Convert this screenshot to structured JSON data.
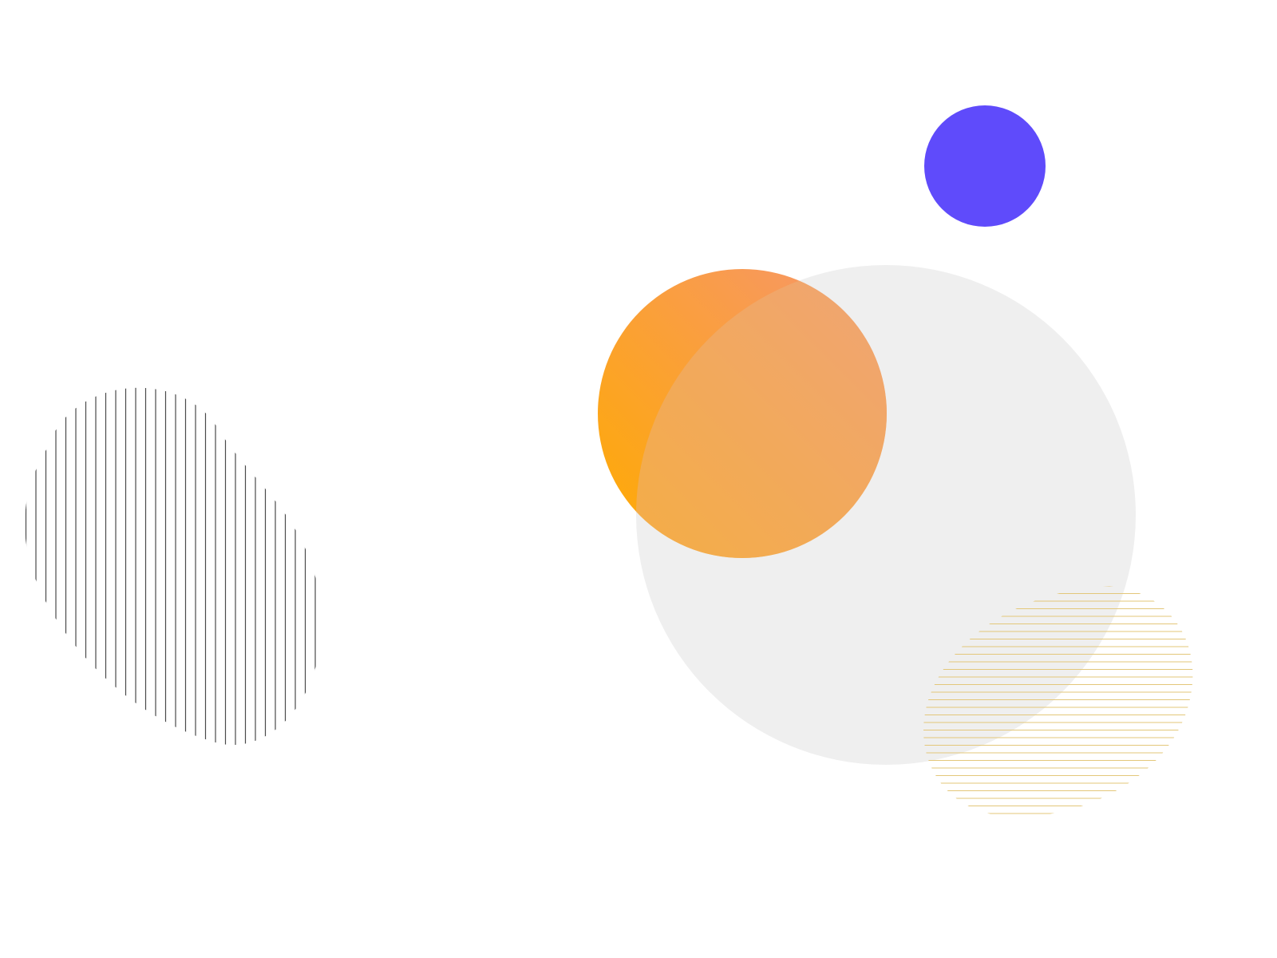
{
  "background": "#ffffff",
  "colors": {
    "indigo_circle": "#5f4bfb",
    "large_circle": "#efefef",
    "gradient_start": "#ffab00",
    "gradient_end": "#f6956f",
    "overlap_tint": "#ebb07a",
    "vertical_lines": "#4a4a4a",
    "horizontal_lines": "#e3c77a"
  },
  "shapes": [
    {
      "name": "indigo-circle",
      "kind": "filled-circle",
      "color": "indigo_circle"
    },
    {
      "name": "large-gray-circle",
      "kind": "filled-circle",
      "color": "large_circle"
    },
    {
      "name": "gradient-orange-circle",
      "kind": "gradient-circle",
      "colors": [
        "gradient_start",
        "gradient_end"
      ]
    },
    {
      "name": "vertical-line-blob",
      "kind": "line-pattern",
      "orientation": "vertical",
      "color": "vertical_lines"
    },
    {
      "name": "horizontal-line-blob",
      "kind": "line-pattern",
      "orientation": "horizontal",
      "color": "horizontal_lines"
    }
  ]
}
